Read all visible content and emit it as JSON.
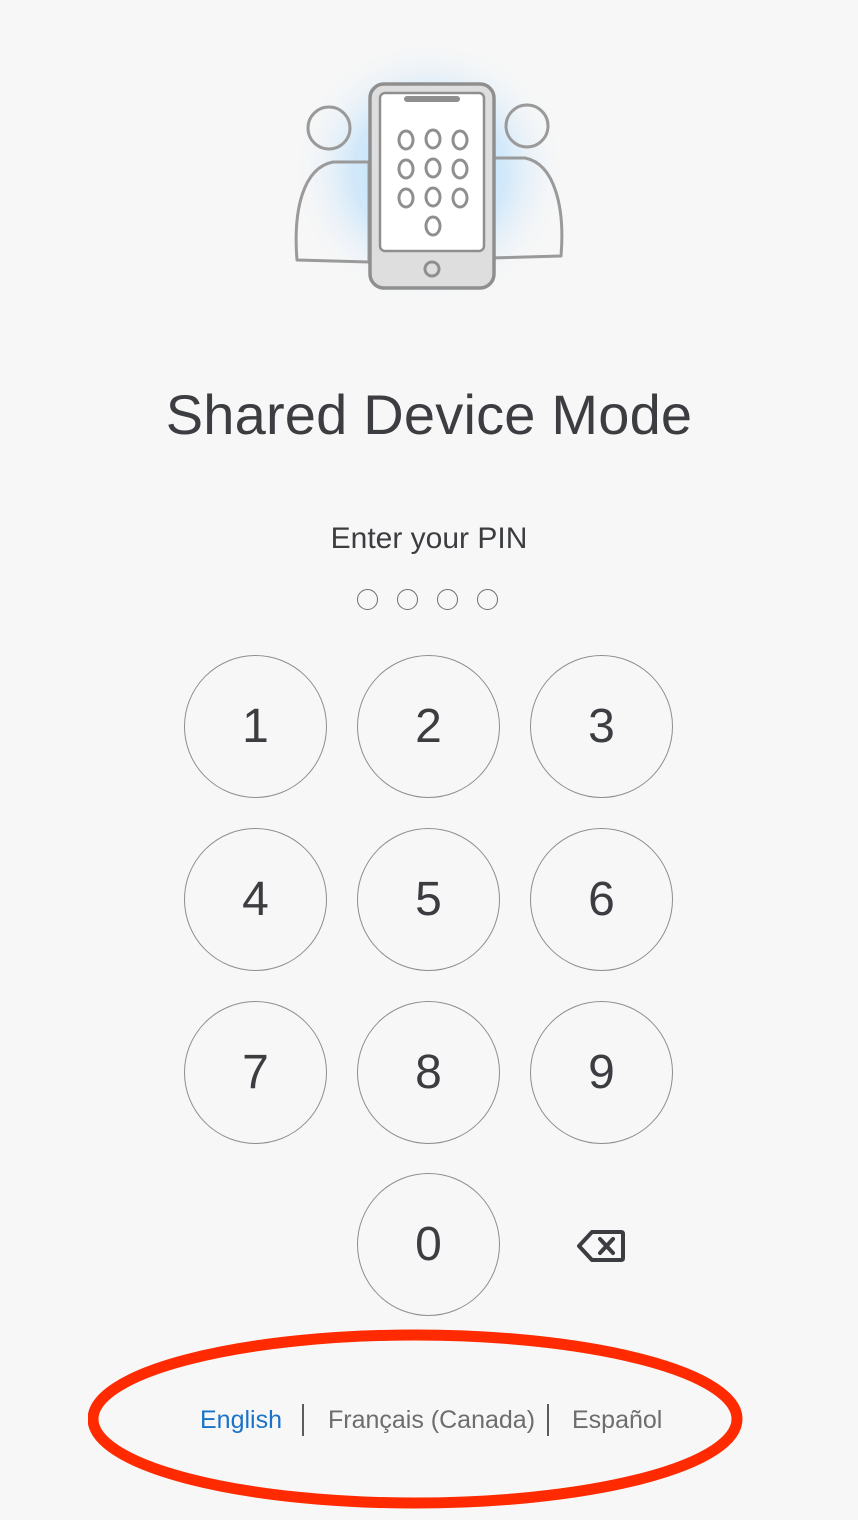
{
  "header": {
    "title": "Shared Device Mode",
    "subtitle": "Enter your PIN",
    "hero_icon": "shared-device-illustration"
  },
  "pin": {
    "length": 4,
    "filled": 0
  },
  "keypad": {
    "keys": [
      "1",
      "2",
      "3",
      "4",
      "5",
      "6",
      "7",
      "8",
      "9",
      "0"
    ],
    "backspace_icon": "backspace-icon"
  },
  "languages": {
    "items": [
      {
        "label": "English",
        "selected": true
      },
      {
        "label": "Français (Canada)",
        "selected": false
      },
      {
        "label": "Español",
        "selected": false
      }
    ]
  },
  "colors": {
    "background": "#f7f7f7",
    "text": "#3c3d41",
    "accent_link": "#1a73c8",
    "inactive_link": "#6d6d6d",
    "annotation": "#ff2a00",
    "hero_glow": "#bfe0fb"
  }
}
